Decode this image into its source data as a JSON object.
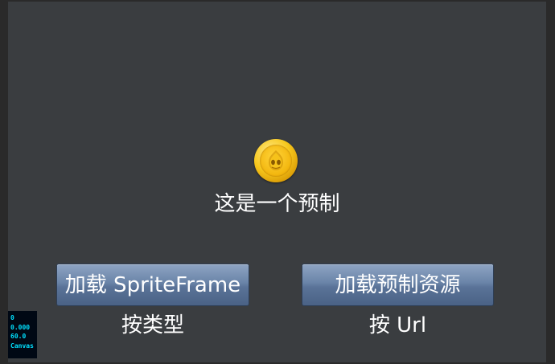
{
  "scene": {
    "prefab_label": "这是一个预制",
    "coin_icon": "coin-icon"
  },
  "buttons": {
    "load_spriteframe": "加载 SpriteFrame",
    "load_prefab": "加载预制资源"
  },
  "captions": {
    "by_type": "按类型",
    "by_url": "按 Url"
  },
  "stats": {
    "draw_calls": "0",
    "frame_time": "0.000",
    "fps": "60.0",
    "renderer": "Canvas"
  }
}
